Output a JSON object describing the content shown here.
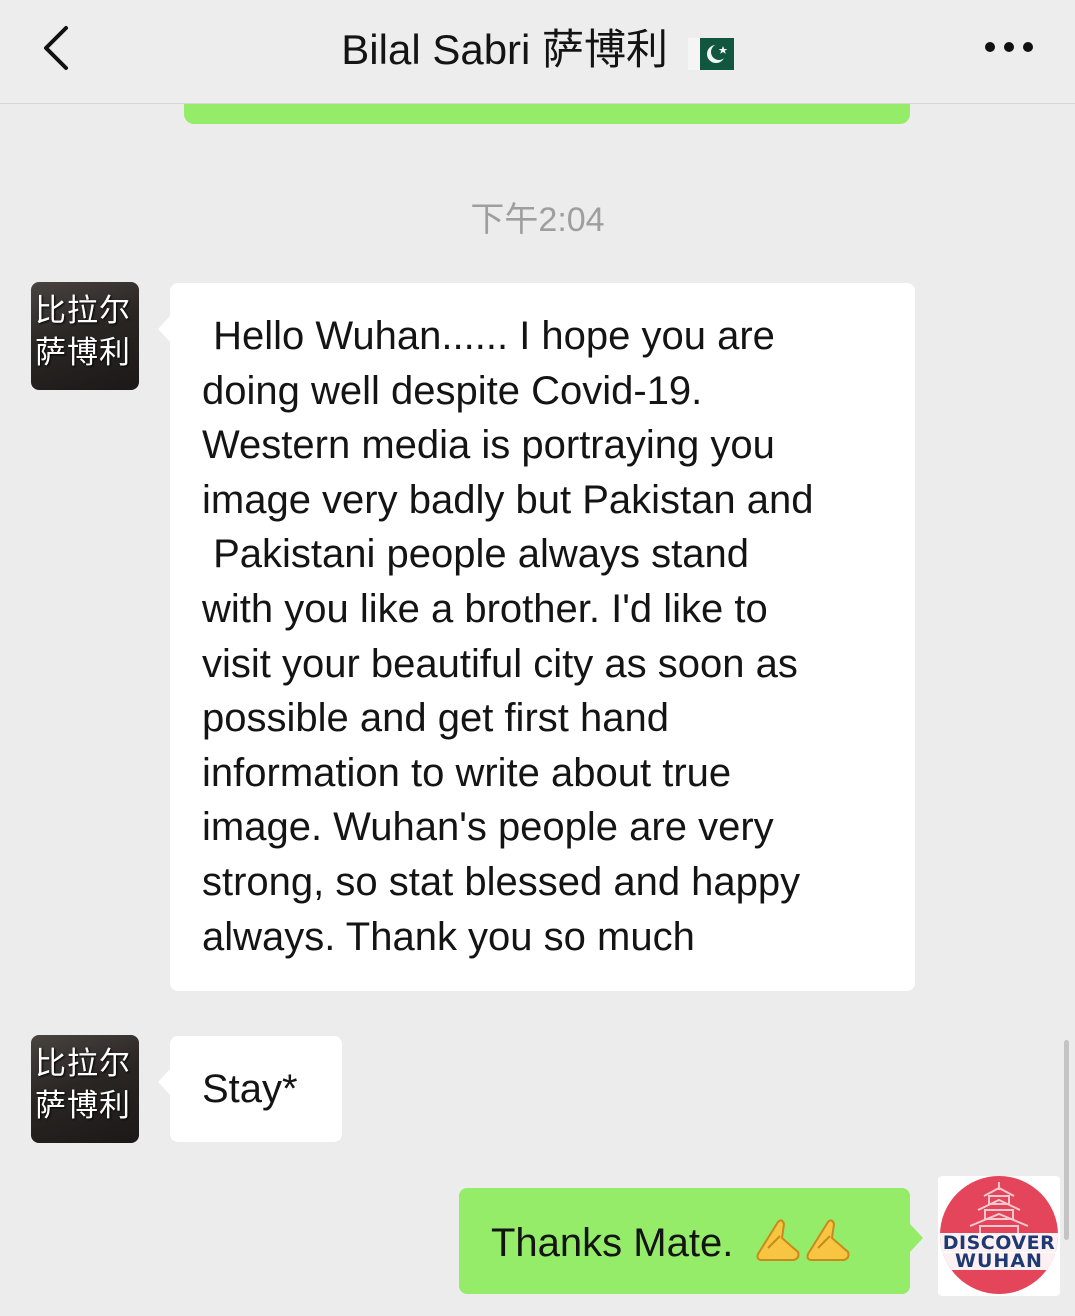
{
  "header": {
    "title": "Bilal Sabri 萨博利",
    "back_icon": "chevron-left-icon",
    "more_icon": "more-dots-icon",
    "flag_icon": "pakistan-flag-icon"
  },
  "timestamp": "下午2:04",
  "contact": {
    "avatar_text": "比拉尔\n萨博利"
  },
  "messages": [
    {
      "side": "left",
      "lines": [
        " Hello Wuhan...... I hope you are",
        "doing well despite Covid-19.",
        "Western media is portraying you",
        "image very badly but Pakistan and",
        " Pakistani people always stand",
        "with you like a brother. I'd like to",
        "visit your beautiful city as soon as",
        "possible and get first hand",
        "information to write about true",
        "image. Wuhan's people are very",
        "strong, so stat blessed and happy",
        "always. Thank you so much"
      ]
    },
    {
      "side": "left",
      "text": "Stay*"
    },
    {
      "side": "right",
      "text": "Thanks Mate.",
      "emoji": "folded-hands-icon"
    }
  ],
  "my_avatar": {
    "logo_line1": "DISCOVER",
    "logo_line2": "WUHAN"
  },
  "colors": {
    "background": "#ececec",
    "bubble_incoming": "#ffffff",
    "bubble_outgoing": "#95ec69",
    "timestamp": "#9e9e9e"
  }
}
